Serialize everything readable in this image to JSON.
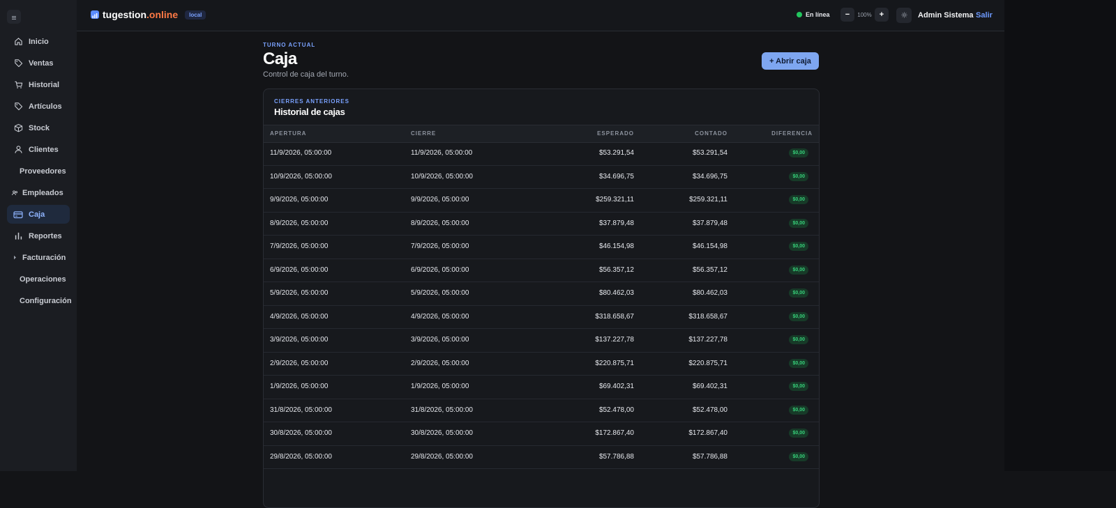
{
  "colors": {
    "accent": "#7aa2ff",
    "primary_button": "#7ea6f0",
    "online": "#22c55e",
    "brand_tld": "#ff7a45",
    "diff_badge_bg": "#173a28",
    "diff_badge_text": "#37d07a"
  },
  "sidebar": {
    "collapse_icon": "menu-icon",
    "items": [
      {
        "label": "Inicio",
        "icon": "home-icon"
      },
      {
        "label": "Ventas",
        "icon": "tag-icon"
      },
      {
        "label": "Historial",
        "icon": "cart-icon"
      },
      {
        "label": "Artículos",
        "icon": "tag-icon"
      },
      {
        "label": "Stock",
        "icon": "box-icon"
      },
      {
        "label": "Clientes",
        "icon": "user-icon"
      },
      {
        "label": "Proveedores",
        "icon": ""
      },
      {
        "label": "Empleados",
        "icon": "users-icon"
      },
      {
        "label": "Caja",
        "icon": "credit-card-icon",
        "active": true
      },
      {
        "label": "Reportes",
        "icon": "bar-chart-icon"
      },
      {
        "label": "Facturación",
        "icon": "chevron-right-icon"
      },
      {
        "label": "Operaciones",
        "icon": ""
      },
      {
        "label": "Configuración",
        "icon": ""
      }
    ]
  },
  "header": {
    "brand_name": "tugestion",
    "brand_tld": ".online",
    "env_badge": "local",
    "status": "En línea",
    "zoom_minus": "−",
    "zoom_level": "100%",
    "zoom_plus": "+",
    "user_name": "Admin Sistema",
    "logout": "Salir"
  },
  "page": {
    "eyebrow": "TURNO ACTUAL",
    "title": "Caja",
    "subtitle": "Control de caja del turno.",
    "open_button": "+ Abrir caja"
  },
  "history": {
    "eyebrow": "CIERRES ANTERIORES",
    "title": "Historial de cajas",
    "columns": [
      "APERTURA",
      "CIERRE",
      "ESPERADO",
      "CONTADO",
      "DIFERENCIA"
    ],
    "rows": [
      {
        "apertura": "11/9/2026, 05:00:00",
        "cierre": "11/9/2026, 05:00:00",
        "esperado": "$53.291,54",
        "contado": "$53.291,54",
        "diferencia": "$0,00"
      },
      {
        "apertura": "10/9/2026, 05:00:00",
        "cierre": "10/9/2026, 05:00:00",
        "esperado": "$34.696,75",
        "contado": "$34.696,75",
        "diferencia": "$0,00"
      },
      {
        "apertura": "9/9/2026, 05:00:00",
        "cierre": "9/9/2026, 05:00:00",
        "esperado": "$259.321,11",
        "contado": "$259.321,11",
        "diferencia": "$0,00"
      },
      {
        "apertura": "8/9/2026, 05:00:00",
        "cierre": "8/9/2026, 05:00:00",
        "esperado": "$37.879,48",
        "contado": "$37.879,48",
        "diferencia": "$0,00"
      },
      {
        "apertura": "7/9/2026, 05:00:00",
        "cierre": "7/9/2026, 05:00:00",
        "esperado": "$46.154,98",
        "contado": "$46.154,98",
        "diferencia": "$0,00"
      },
      {
        "apertura": "6/9/2026, 05:00:00",
        "cierre": "6/9/2026, 05:00:00",
        "esperado": "$56.357,12",
        "contado": "$56.357,12",
        "diferencia": "$0,00"
      },
      {
        "apertura": "5/9/2026, 05:00:00",
        "cierre": "5/9/2026, 05:00:00",
        "esperado": "$80.462,03",
        "contado": "$80.462,03",
        "diferencia": "$0,00"
      },
      {
        "apertura": "4/9/2026, 05:00:00",
        "cierre": "4/9/2026, 05:00:00",
        "esperado": "$318.658,67",
        "contado": "$318.658,67",
        "diferencia": "$0,00"
      },
      {
        "apertura": "3/9/2026, 05:00:00",
        "cierre": "3/9/2026, 05:00:00",
        "esperado": "$137.227,78",
        "contado": "$137.227,78",
        "diferencia": "$0,00"
      },
      {
        "apertura": "2/9/2026, 05:00:00",
        "cierre": "2/9/2026, 05:00:00",
        "esperado": "$220.875,71",
        "contado": "$220.875,71",
        "diferencia": "$0,00"
      },
      {
        "apertura": "1/9/2026, 05:00:00",
        "cierre": "1/9/2026, 05:00:00",
        "esperado": "$69.402,31",
        "contado": "$69.402,31",
        "diferencia": "$0,00"
      },
      {
        "apertura": "31/8/2026, 05:00:00",
        "cierre": "31/8/2026, 05:00:00",
        "esperado": "$52.478,00",
        "contado": "$52.478,00",
        "diferencia": "$0,00"
      },
      {
        "apertura": "30/8/2026, 05:00:00",
        "cierre": "30/8/2026, 05:00:00",
        "esperado": "$172.867,40",
        "contado": "$172.867,40",
        "diferencia": "$0,00"
      },
      {
        "apertura": "29/8/2026, 05:00:00",
        "cierre": "29/8/2026, 05:00:00",
        "esperado": "$57.786,88",
        "contado": "$57.786,88",
        "diferencia": "$0,00"
      }
    ]
  }
}
